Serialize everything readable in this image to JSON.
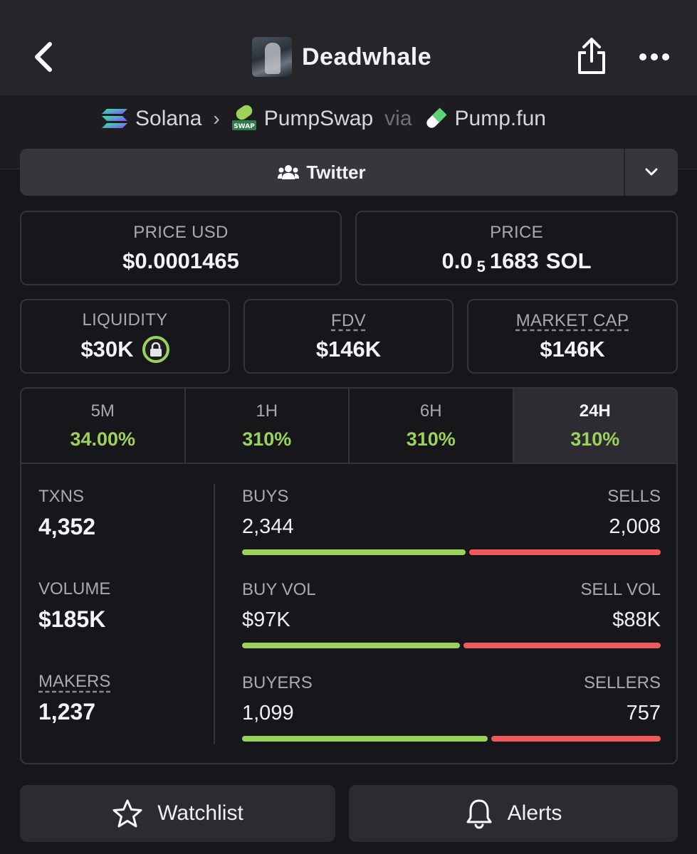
{
  "header": {
    "token_name": "Deadwhale",
    "back_icon": "chevron-left-icon",
    "share_icon": "share-icon",
    "more_icon": "more-horizontal-icon"
  },
  "breadcrumb": {
    "chain": "Solana",
    "dex": "PumpSwap",
    "via": "via",
    "launchpad": "Pump.fun",
    "dex_badge": "SWAP"
  },
  "social": {
    "label": "Twitter",
    "icon": "users-icon"
  },
  "price": {
    "usd_label": "PRICE USD",
    "usd_value": "$0.0001465",
    "native_label": "PRICE",
    "native_prefix": "0.0",
    "native_zeros": "5",
    "native_digits": "1683",
    "native_unit": "SOL"
  },
  "metrics": {
    "liquidity_label": "LIQUIDITY",
    "liquidity_value": "$30K",
    "fdv_label": "FDV",
    "fdv_value": "$146K",
    "mcap_label": "MARKET CAP",
    "mcap_value": "$146K"
  },
  "timeframes": [
    {
      "label": "5M",
      "change": "34.00%"
    },
    {
      "label": "1H",
      "change": "310%"
    },
    {
      "label": "6H",
      "change": "310%"
    },
    {
      "label": "24H",
      "change": "310%"
    }
  ],
  "active_timeframe": "24H",
  "stats": {
    "txns_label": "TXNS",
    "txns_value": "4,352",
    "volume_label": "VOLUME",
    "volume_value": "$185K",
    "makers_label": "MAKERS",
    "makers_value": "1,237"
  },
  "splits": [
    {
      "left_label": "BUYS",
      "left_value": "2,344",
      "right_label": "SELLS",
      "right_value": "2,008",
      "left_fraction": 0.5386
    },
    {
      "left_label": "BUY VOL",
      "left_value": "$97K",
      "right_label": "SELL VOL",
      "right_value": "$88K",
      "left_fraction": 0.5243
    },
    {
      "left_label": "BUYERS",
      "left_value": "1,099",
      "right_label": "SELLERS",
      "right_value": "757",
      "left_fraction": 0.5921
    }
  ],
  "actions": {
    "watchlist_label": "Watchlist",
    "alerts_label": "Alerts"
  },
  "colors": {
    "positive": "#9bd35a",
    "negative": "#f05a5a",
    "background": "#17171b"
  }
}
